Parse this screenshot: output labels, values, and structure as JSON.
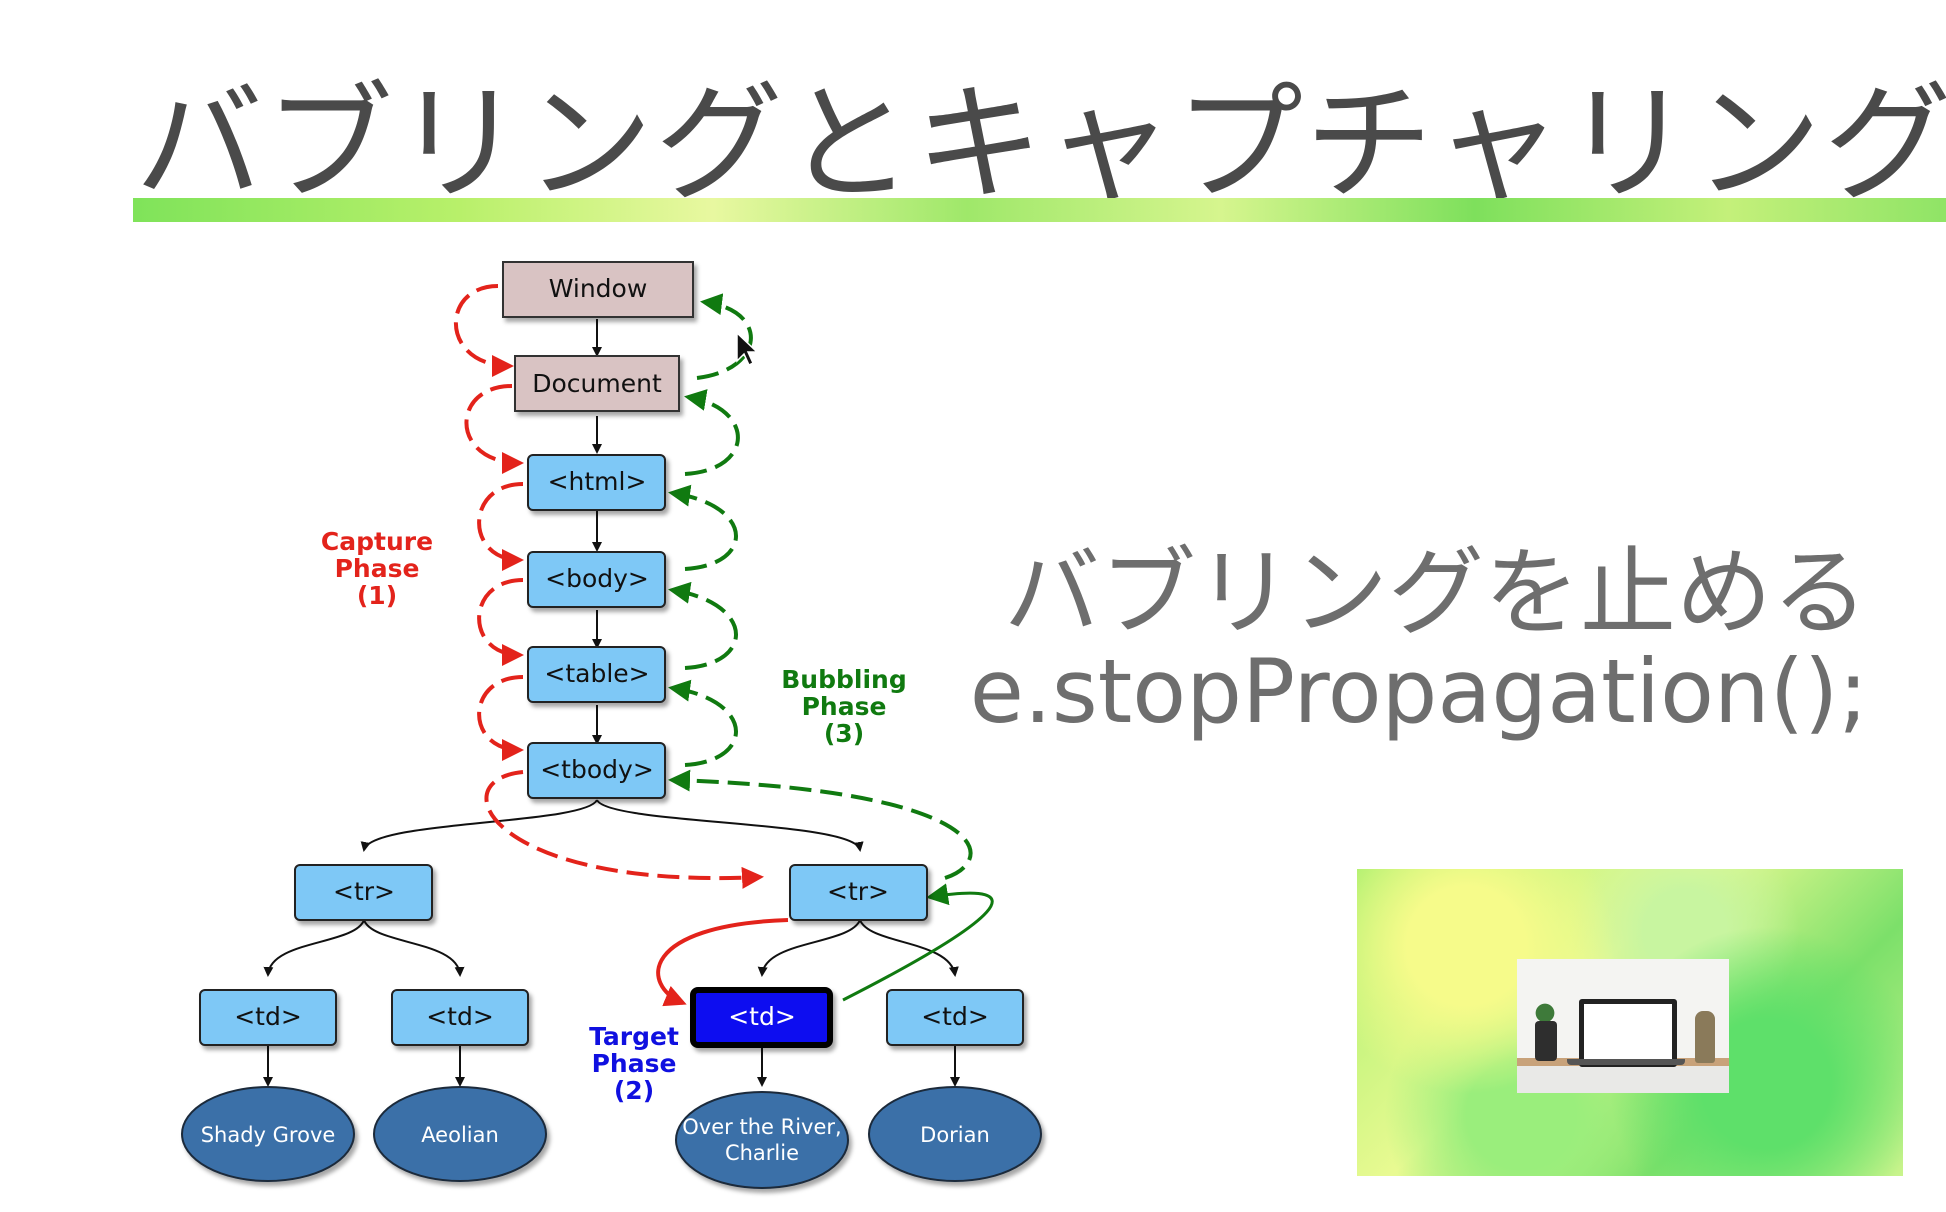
{
  "slide": {
    "title": "バブリングとキャプチャリング",
    "caption_line1": "バブリングを止める",
    "caption_line2": "e.stopPropagation();"
  },
  "diagram": {
    "nodes": {
      "window": "Window",
      "document": "Document",
      "html": "<html>",
      "body": "<body>",
      "table": "<table>",
      "tbody": "<tbody>",
      "tr_left": "<tr>",
      "tr_right": "<tr>",
      "td1": "<td>",
      "td2": "<td>",
      "td3": "<td>",
      "td4": "<td>"
    },
    "leaves": {
      "leaf1": "Shady Grove",
      "leaf2": "Aeolian",
      "leaf3_line1": "Over the River,",
      "leaf3_line2": "Charlie",
      "leaf4": "Dorian"
    },
    "capture_phase": [
      "Capture",
      "Phase",
      "(1)"
    ],
    "bubbling_phase": [
      "Bubbling",
      "Phase",
      "(3)"
    ],
    "target_phase": [
      "Target",
      "Phase",
      "(2)"
    ],
    "colors": {
      "capture": "#e3231b",
      "bubbling": "#107a10",
      "target": "#1010e0",
      "node_blue": "#7ec8f6",
      "node_grey": "#d9c3c3",
      "leaf": "#3a6fa8"
    }
  }
}
